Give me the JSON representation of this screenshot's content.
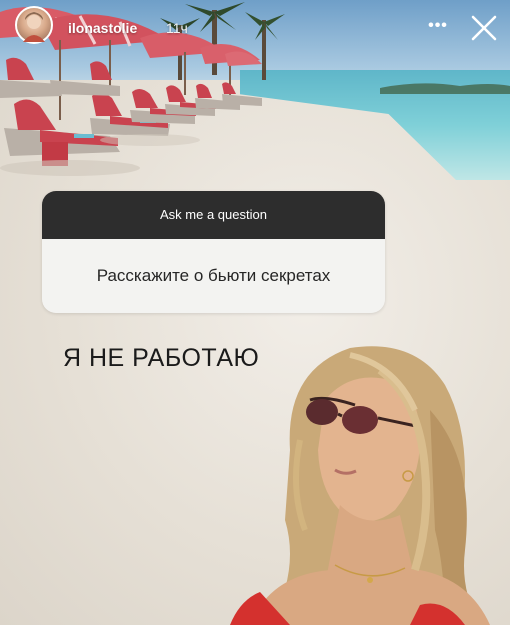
{
  "header": {
    "username": "ilonastolie",
    "time": "11ч",
    "more_icon": "•••",
    "close_icon": "close-icon",
    "avatar_icon": "avatar-icon"
  },
  "question_sticker": {
    "prompt": "Ask me a question",
    "question": "Расскажите о бьюти секретах"
  },
  "caption": "Я НЕ РАБОТАЮ",
  "colors": {
    "sticker_header": "#2d2d2d",
    "sticker_body": "#f3f3f1",
    "chair": "#c9434f",
    "umbrella": "#d95b66"
  }
}
